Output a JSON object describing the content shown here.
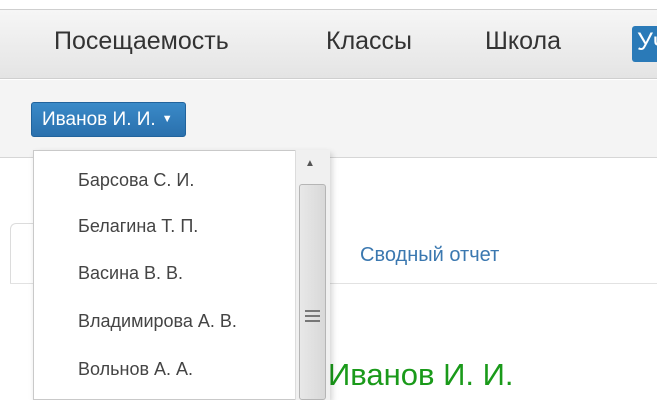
{
  "navbar": {
    "items": [
      {
        "label": "Посещаемость"
      },
      {
        "label": "Классы"
      },
      {
        "label": "Школа"
      },
      {
        "label": "Уч"
      }
    ]
  },
  "user_selector": {
    "label": "Иванов И. И.",
    "caret": "▼"
  },
  "dropdown": {
    "items": [
      {
        "label": "Барсова С. И."
      },
      {
        "label": "Белагина Т. П."
      },
      {
        "label": "Васина В. В."
      },
      {
        "label": "Владимирова А. В."
      },
      {
        "label": "Вольнов А. А."
      }
    ]
  },
  "tabs": {
    "summary_label": "Сводный отчет"
  },
  "main": {
    "student_name": "Иванов И. И."
  },
  "colors": {
    "accent": "#2a7ab8",
    "name_green": "#1a9a1a",
    "link_blue": "#3b78b0"
  }
}
